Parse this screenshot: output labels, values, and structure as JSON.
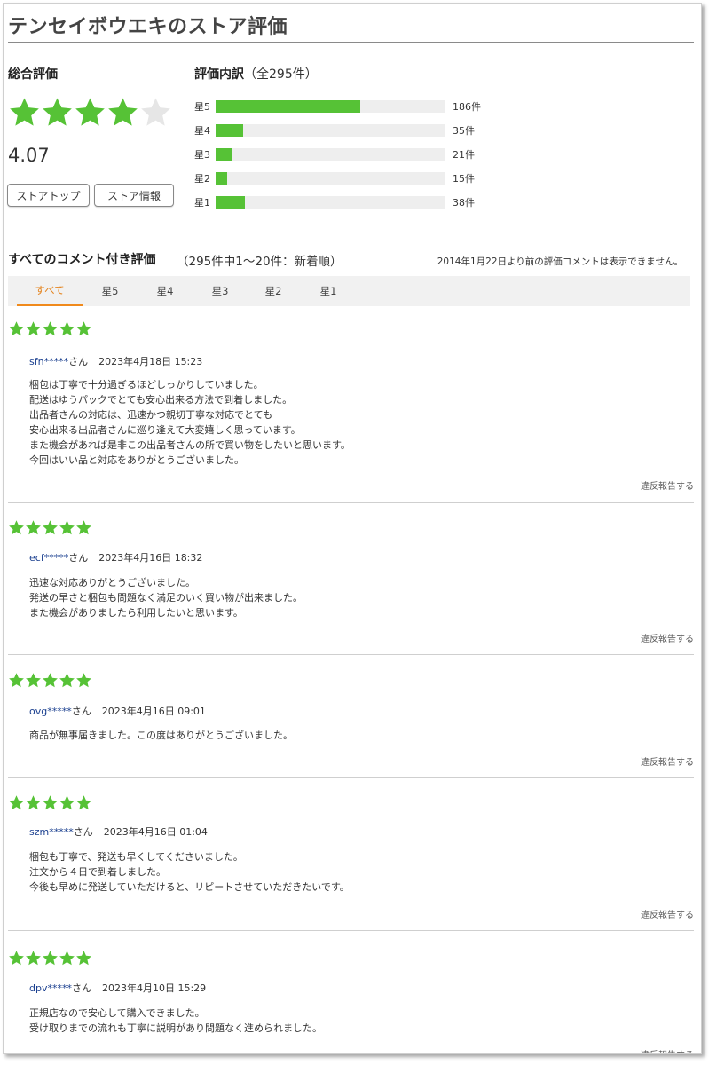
{
  "page": {
    "title": "テンセイボウエキのストア評価"
  },
  "overall": {
    "label": "総合評価",
    "score": "4.07",
    "filled_stars": 4,
    "star_color": "#56c236",
    "empty_star_color": "#e6e6e6",
    "buttons": {
      "store_top": "ストアトップ",
      "store_info": "ストア情報"
    }
  },
  "breakdown": {
    "label": "評価内訳",
    "total": "（全295件）",
    "rows": [
      {
        "label": "星5",
        "count": "186件",
        "value": 186
      },
      {
        "label": "星4",
        "count": "35件",
        "value": 35
      },
      {
        "label": "星3",
        "count": "21件",
        "value": 21
      },
      {
        "label": "星2",
        "count": "15件",
        "value": 15
      },
      {
        "label": "星1",
        "count": "38件",
        "value": 38
      }
    ],
    "max": 295,
    "bar_color": "#56c236"
  },
  "reviews_section": {
    "title": "すべてのコメント付き評価",
    "subtitle": "（295件中1～20件：新着順）",
    "note": "2014年1月22日より前の評価コメントは表示できません。",
    "tabs": [
      "すべて",
      "星5",
      "星4",
      "星3",
      "星2",
      "星1"
    ],
    "active_tab": "すべて",
    "accent_color": "#f08a1c"
  },
  "report_label": "違反報告する",
  "reviews": [
    {
      "stars": 5,
      "user": "sfn*****",
      "honorific": "さん",
      "date": "2023年4月18日 15:23",
      "lines": [
        "梱包は丁寧で十分過ぎるほどしっかりしていました。",
        "配送はゆうパックでとても安心出来る方法で到着しました。",
        "出品者さんの対応は、迅速かつ親切丁寧な対応でとても",
        "安心出来る出品者さんに巡り逢えて大変嬉しく思っています。",
        "また機会があれば是非この出品者さんの所で買い物をしたいと思います。",
        "今回はいい品と対応をありがとうございました。"
      ]
    },
    {
      "stars": 5,
      "user": "ecf*****",
      "honorific": "さん",
      "date": "2023年4月16日 18:32",
      "lines": [
        "迅速な対応ありがとうございました。",
        "発送の早さと梱包も問題なく満足のいく買い物が出来ました。",
        "また機会がありましたら利用したいと思います。"
      ]
    },
    {
      "stars": 5,
      "user": "ovg*****",
      "honorific": "さん",
      "date": "2023年4月16日 09:01",
      "lines": [
        "商品が無事届きました。この度はありがとうございました。"
      ]
    },
    {
      "stars": 5,
      "user": "szm*****",
      "honorific": "さん",
      "date": "2023年4月16日 01:04",
      "lines": [
        "梱包も丁寧で、発送も早くしてくださいました。",
        "注文から４日で到着しました。",
        "今後も早めに発送していただけると、リピートさせていただきたいです。"
      ]
    },
    {
      "stars": 5,
      "user": "dpv*****",
      "honorific": "さん",
      "date": "2023年4月10日 15:29",
      "lines": [
        "正規店なので安心して購入できました。",
        "受け取りまでの流れも丁寧に説明があり問題なく進められました。"
      ]
    }
  ]
}
